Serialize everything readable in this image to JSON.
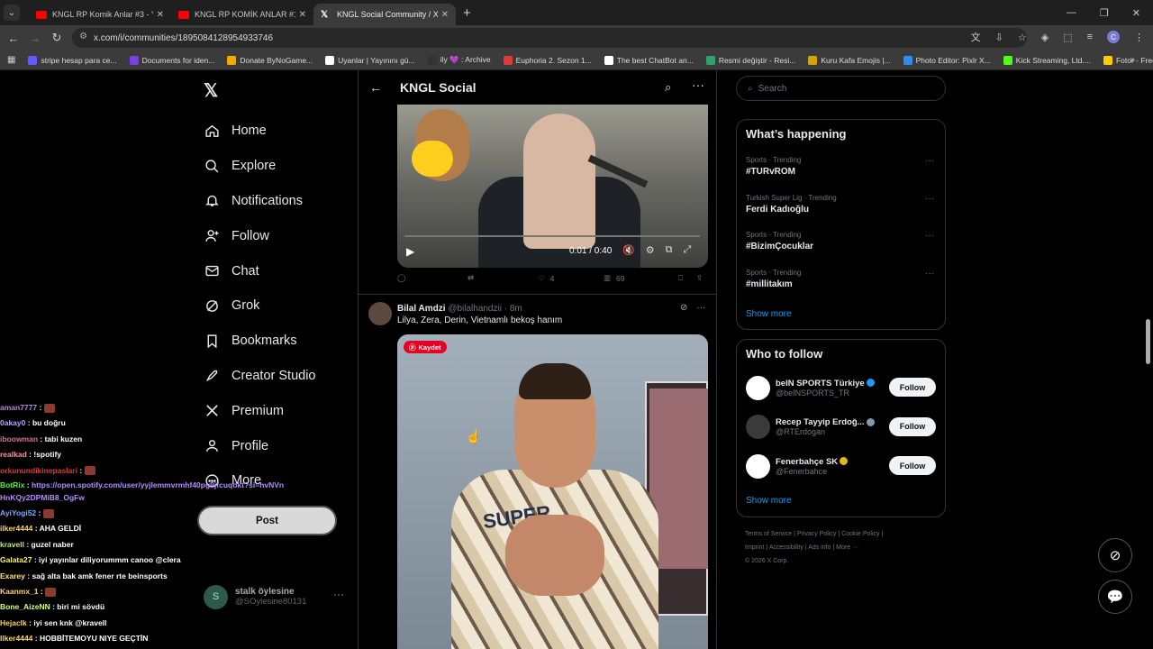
{
  "browser": {
    "tabs": [
      {
        "label": "KNGL RP Komik Anlar #3 - YouT",
        "type": "youtube"
      },
      {
        "label": "KNGL RP KOMİK ANLAR #12 - Y",
        "type": "youtube"
      },
      {
        "label": "KNGL Social Community / X",
        "type": "x"
      }
    ],
    "url": "x.com/i/communities/1895084128954933746",
    "profile_initial": "C",
    "bookmarks": [
      {
        "label": "stripe hesap para ce...",
        "color": "#635bff"
      },
      {
        "label": "Documents for iden...",
        "color": "#7b3fe4"
      },
      {
        "label": "Donate ByNoGame...",
        "color": "#f2a900"
      },
      {
        "label": "Uyanlar | Yayınını gü...",
        "color": "#ffffff"
      },
      {
        "label": "ily 💜 : Archive",
        "color": "#333333"
      },
      {
        "label": "Euphoria 2. Sezon 1...",
        "color": "#e03a3a"
      },
      {
        "label": "The best ChatBot an...",
        "color": "#ffffff"
      },
      {
        "label": "Resmi değiştir - Resi...",
        "color": "#2fa36b"
      },
      {
        "label": "Kuru Kafa Emojis |...",
        "color": "#d9a200"
      },
      {
        "label": "Photo Editor: Pixlr X...",
        "color": "#2b8ef0"
      },
      {
        "label": "Kick Streaming, Ltd....",
        "color": "#53fc18"
      },
      {
        "label": "Fotor - Free Online...",
        "color": "#ffcc00"
      }
    ]
  },
  "sidebar": {
    "items": [
      {
        "label": "Home",
        "icon": "home-icon"
      },
      {
        "label": "Explore",
        "icon": "search-icon"
      },
      {
        "label": "Notifications",
        "icon": "bell-icon"
      },
      {
        "label": "Follow",
        "icon": "follow-icon"
      },
      {
        "label": "Chat",
        "icon": "mail-icon"
      },
      {
        "label": "Grok",
        "icon": "grok-icon"
      },
      {
        "label": "Bookmarks",
        "icon": "bookmark-icon"
      },
      {
        "label": "Creator Studio",
        "icon": "rocket-icon"
      },
      {
        "label": "Premium",
        "icon": "x-icon"
      },
      {
        "label": "Profile",
        "icon": "user-icon"
      },
      {
        "label": "More",
        "icon": "more-icon"
      }
    ],
    "post_label": "Post",
    "account": {
      "name": "stalk öylesine",
      "handle": "@SOylesine80131",
      "initial": "S"
    }
  },
  "chat": [
    {
      "user": "aman7777",
      "msg": "",
      "color": "#b08bd6",
      "emote": true
    },
    {
      "user": "0akay0",
      "msg": "bu doğru",
      "color": "#b5a4ff"
    },
    {
      "user": "iboowman",
      "msg": "tabi kuzen",
      "color": "#d16fa0"
    },
    {
      "user": "realkad",
      "msg": "!spotify",
      "color": "#ff8fb1"
    },
    {
      "user": "orkunundikinepaslari",
      "msg": "",
      "color": "#d9383a",
      "emote": true
    },
    {
      "user": "BotRix",
      "msg": "https://open.spotify.com/user/yyjlemmvrmhf40pg9jfcuqokt?si=hvNVnHnKQy2DPMiB8_OgFw",
      "color": "#53fc18",
      "link": true
    },
    {
      "user": "AyiYogi52",
      "msg": "",
      "color": "#7aa9ff",
      "emote": true
    },
    {
      "user": "ilker4444",
      "msg": "AHA GELDİ",
      "color": "#ffd36b"
    },
    {
      "user": "kravell",
      "msg": "guzel naber",
      "color": "#c0e96b"
    },
    {
      "user": "Galata27",
      "msg": "iyi yayınlar diliyorummm canoo @clera",
      "color": "#fff066"
    },
    {
      "user": "Exarey",
      "msg": "sağ alta bak amk fener rte beinsports",
      "color": "#ffe36b"
    },
    {
      "user": "Kaanmx_1",
      "msg": "",
      "color": "#ffd36b",
      "emote": true
    },
    {
      "user": "Bone_AizeNN",
      "msg": "biri mi sövdü",
      "color": "#d6ff7b"
    },
    {
      "user": "Hejaclk",
      "msg": "iyi sen knk @kravell",
      "color": "#ffd36b"
    },
    {
      "user": "Ilker4444",
      "msg": "HOBBİTEMOYU NIYE GEÇTİN",
      "color": "#ffd36b"
    }
  ],
  "feed": {
    "title": "KNGL Social",
    "video1": {
      "time": "0:01 / 0:40"
    },
    "actions1": {
      "likes": "4",
      "views": "69"
    },
    "post2": {
      "name": "Bilal Amdzi",
      "handle": "@bilalhandzii · 8m",
      "text": "Lilya, Zera, Derin, Vietnamlı bekoş hanım",
      "badge": "Kaydet",
      "shirt_text": "SUPER"
    }
  },
  "right": {
    "search_placeholder": "Search",
    "happening_title": "What’s happening",
    "trends": [
      {
        "context": "Sports · Trending",
        "title": "#TURvROM"
      },
      {
        "context": "Turkish Super Lig · Trending",
        "title": "Ferdi Kadıoğlu"
      },
      {
        "context": "Sports · Trending",
        "title": "#BizimÇocuklar"
      },
      {
        "context": "Sports · Trending",
        "title": "#millitakım"
      }
    ],
    "show_more": "Show more",
    "wtf_title": "Who to follow",
    "follow_label": "Follow",
    "who_to_follow": [
      {
        "name": "beIN SPORTS Türkiye",
        "handle": "@beINSPORTS_TR",
        "avatar_color": "#ffffff",
        "verified_color": "#1d9bf0"
      },
      {
        "name": "Recep Tayyip Erdoğ...",
        "handle": "@RTErdogan",
        "avatar_color": "#3a3a3a",
        "verified_color": "#829aab"
      },
      {
        "name": "Fenerbahçe SK",
        "handle": "@Fenerbahce",
        "avatar_color": "#ffffff",
        "verified_color": "#e2b719"
      }
    ],
    "show_more2": "Show more",
    "footer_line1": "Terms of Service  |  Privacy Policy  |  Cookie Policy  |",
    "footer_line2": "Imprint  |  Accessibility  |  Ads info  |  More ···",
    "footer_line3": "© 2026 X Corp."
  }
}
